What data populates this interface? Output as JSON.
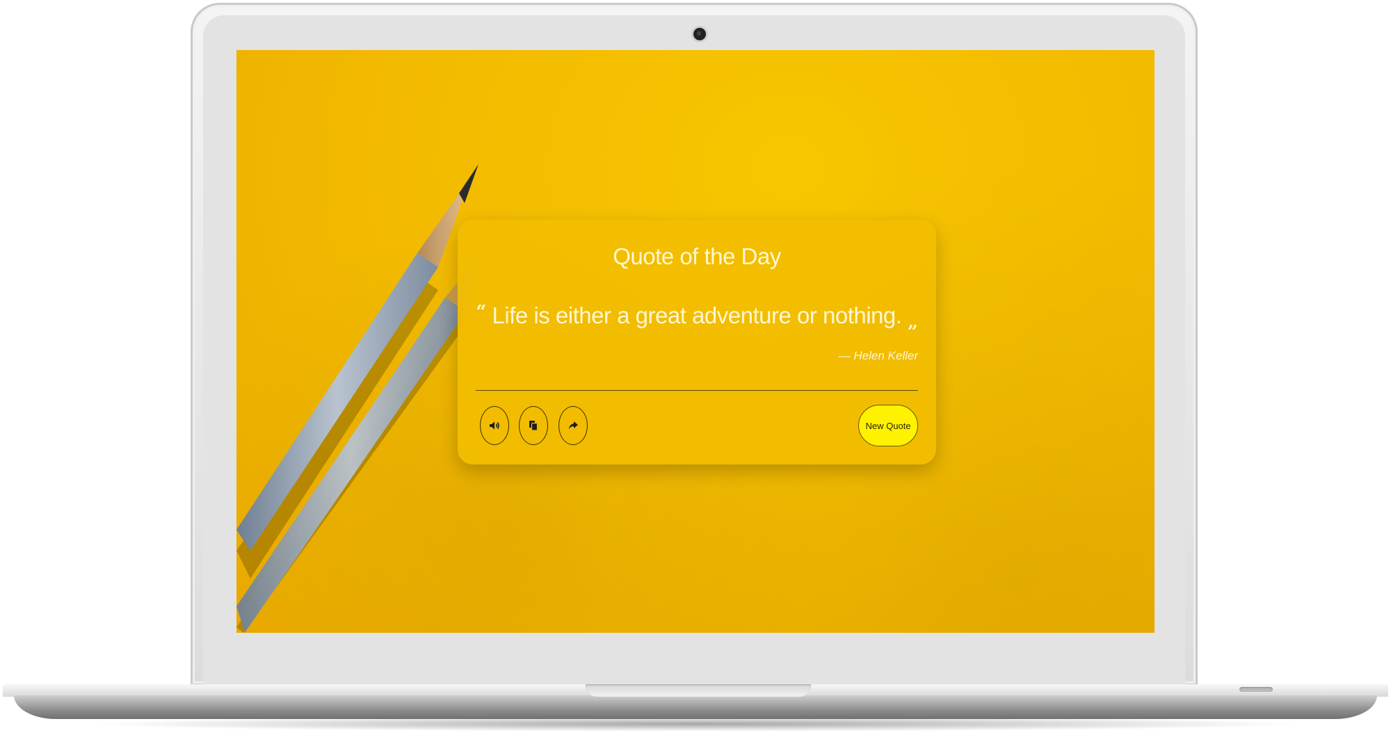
{
  "app": {
    "title": "Quote of the Day"
  },
  "quote": {
    "open_mark": "“",
    "text": "Life is either a great adventure or nothing.",
    "close_mark": "„",
    "author": "— Helen Keller"
  },
  "actions": {
    "speak_icon": "speaker-icon",
    "copy_icon": "copy-icon",
    "share_icon": "share-icon",
    "new_quote_label": "New Quote"
  },
  "colors": {
    "background": "#f2b900",
    "card": "#f2bc00",
    "button": "#fff200",
    "text": "#fff7d0"
  }
}
